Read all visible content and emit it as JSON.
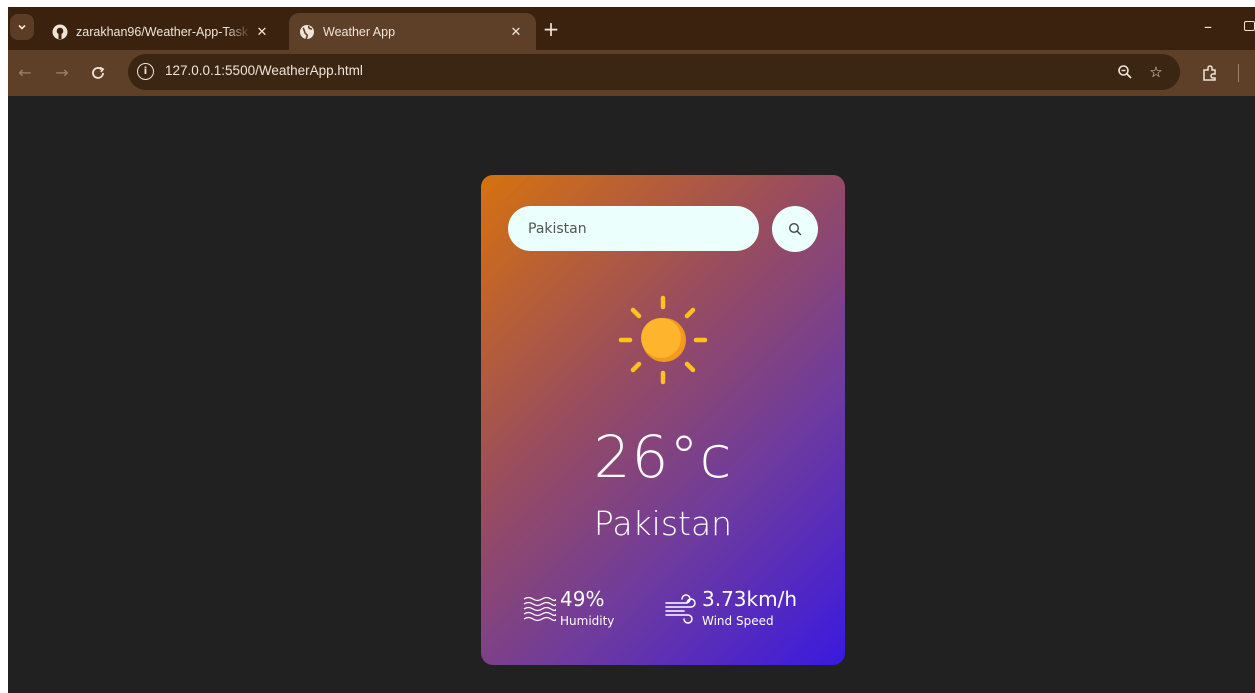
{
  "browser": {
    "tabs": [
      {
        "title": "zarakhan96/Weather-App-Task",
        "favicon": "github-icon",
        "active": false
      },
      {
        "title": "Weather App",
        "favicon": "globe-icon",
        "active": true
      }
    ],
    "address_url": "127.0.0.1:5500/WeatherApp.html"
  },
  "weather_app": {
    "search": {
      "value": "Pakistan",
      "placeholder": ""
    },
    "condition_icon": "sun-icon",
    "temperature": "26°c",
    "city": "Pakistan",
    "humidity": {
      "value": "49%",
      "label": "Humidity",
      "icon": "humidity-waves-icon"
    },
    "wind": {
      "value": "3.73km/h",
      "label": "Wind Speed",
      "icon": "wind-icon"
    }
  },
  "colors": {
    "card_gradient_start": "#d6720f",
    "card_gradient_end": "#3a19e0",
    "page_background": "#212121",
    "input_background": "#ebfffc",
    "browser_frame": "#3a220f",
    "sun": "#ffb42e"
  }
}
